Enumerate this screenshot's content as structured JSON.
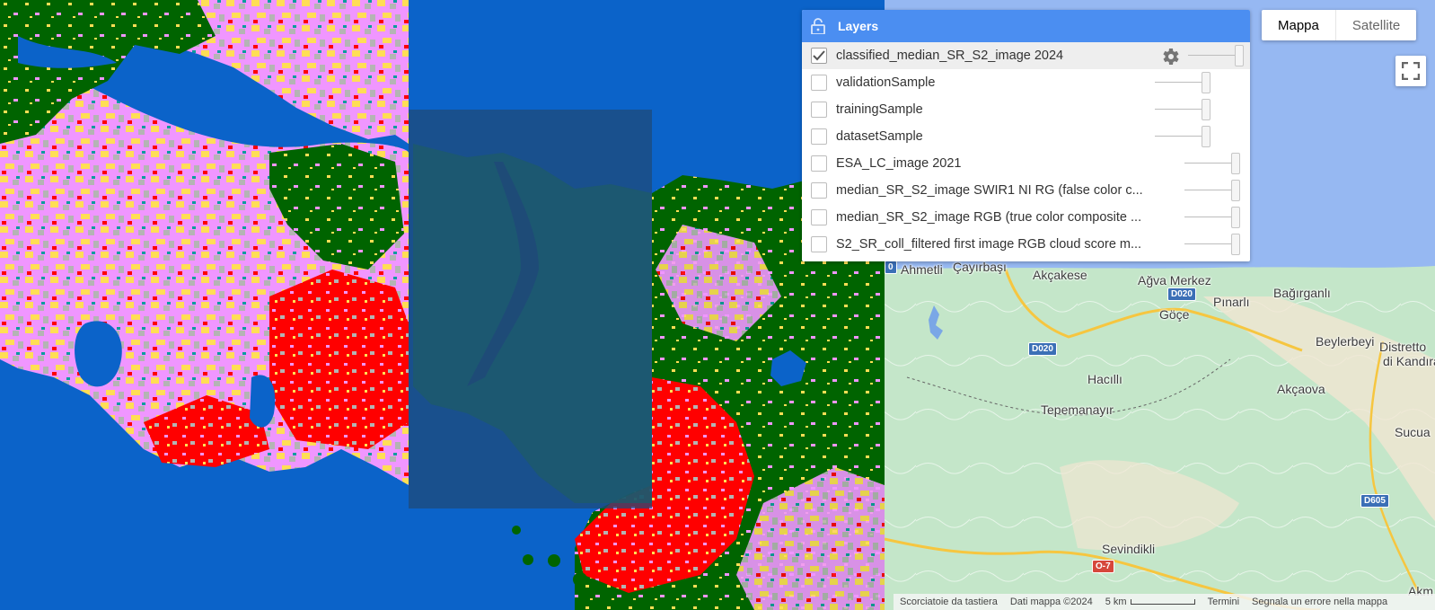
{
  "layers_panel": {
    "title": "Layers",
    "layers": [
      {
        "label": "classified_median_SR_S2_image 2024",
        "checked": true
      },
      {
        "label": "validationSample",
        "checked": false
      },
      {
        "label": "trainingSample",
        "checked": false
      },
      {
        "label": "datasetSample",
        "checked": false
      },
      {
        "label": "ESA_LC_image 2021",
        "checked": false
      },
      {
        "label": "median_SR_S2_image SWIR1 NI RG (false color c...",
        "checked": false
      },
      {
        "label": "median_SR_S2_image RGB (true color composite ...",
        "checked": false
      },
      {
        "label": "S2_SR_coll_filtered first image RGB cloud score m...",
        "checked": false
      }
    ]
  },
  "map_type": {
    "map_label": "Mappa",
    "satellite_label": "Satellite"
  },
  "map_labels": {
    "places": [
      "Ahmetli",
      "Çayırbaşı",
      "Akçakese",
      "Ağva Merkez",
      "Pınarlı",
      "Bağırganlı",
      "Göçe",
      "Beylerbeyi",
      "Distretto",
      "di Kandıra",
      "Hacıllı",
      "Tepemanayır",
      "Akçaova",
      "Sucua",
      "Sevindikli",
      "Akm"
    ],
    "roads": [
      "D020",
      "D020",
      "D605",
      "O-7",
      "0"
    ]
  },
  "footer": {
    "shortcuts": "Scorciatoie da tastiera",
    "data": "Dati mappa ©2024",
    "scale": "5 km",
    "terms": "Termini",
    "report": "Segnala un errore nella mappa"
  },
  "colors": {
    "water": "#0b63c9",
    "forest": "#006400",
    "urban": "#ff0000",
    "grass": "#f096ff",
    "crop": "#ffde55",
    "bare": "#b4b4b4",
    "basemap_green": "#c4e6c9",
    "panel_header": "#4b8ef1"
  }
}
